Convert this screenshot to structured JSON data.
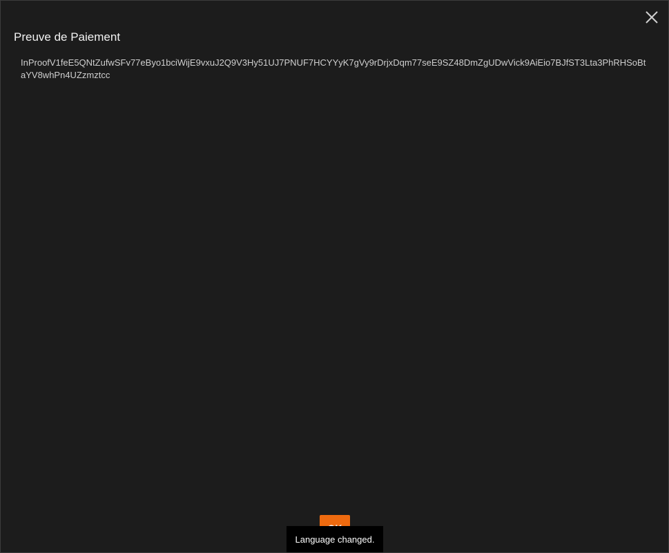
{
  "dialog": {
    "title": "Preuve de Paiement",
    "proof_value": "InProofV1feE5QNtZufwSFv77eByo1bciWijE9vxuJ2Q9V3Hy51UJ7PNUF7HCYYyK7gVy9rDrjxDqm77seE9SZ48DmZgUDwVick9AiEio7BJfST3Lta3PhRHSoBtaYV8whPn4UZzmztcc",
    "close_icon": "close-icon",
    "ok_label": "OK"
  },
  "toast": {
    "message": "Language changed."
  },
  "colors": {
    "background": "#1c1c1c",
    "accent": "#ee6a0f",
    "toast_background": "#000000"
  }
}
